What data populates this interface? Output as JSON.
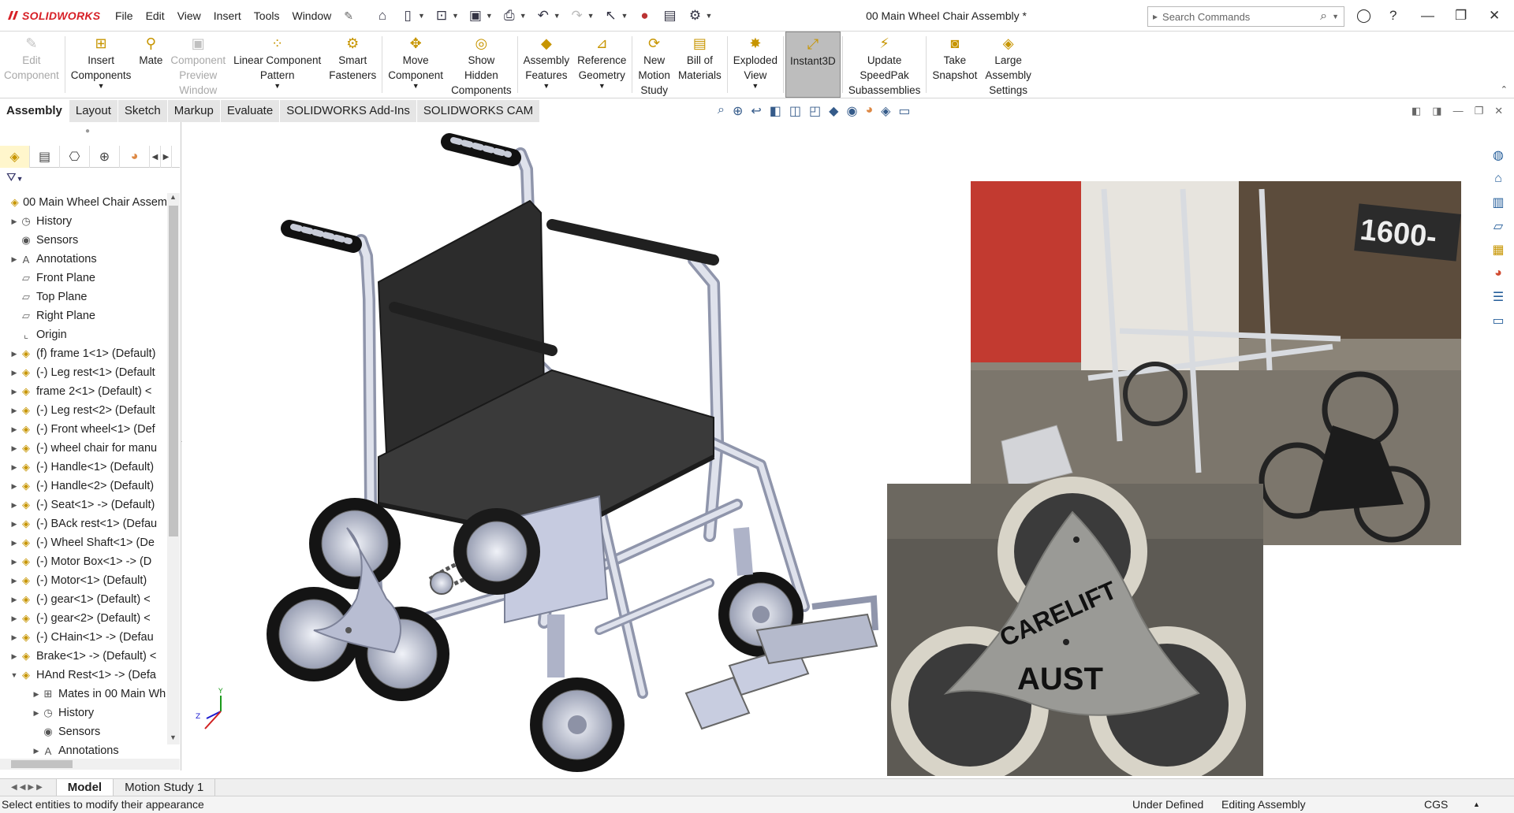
{
  "app": {
    "logo": "SOLIDWORKS",
    "document_title": "00 Main Wheel Chair Assembly *"
  },
  "menu": [
    "File",
    "Edit",
    "View",
    "Insert",
    "Tools",
    "Window"
  ],
  "search": {
    "placeholder": "Search Commands"
  },
  "ribbon": [
    {
      "label": "Edit\nComponent",
      "icon": "edit-component-icon",
      "disabled": true
    },
    {
      "label": "Insert\nComponents",
      "icon": "insert-components-icon",
      "caret": true
    },
    {
      "label": "Mate",
      "icon": "mate-icon"
    },
    {
      "label": "Component\nPreview\nWindow",
      "icon": "preview-window-icon",
      "disabled": true
    },
    {
      "label": "Linear Component\nPattern",
      "icon": "linear-pattern-icon",
      "caret": true
    },
    {
      "label": "Smart\nFasteners",
      "icon": "smart-fasteners-icon"
    },
    {
      "label": "Move\nComponent",
      "icon": "move-component-icon",
      "caret": true
    },
    {
      "label": "Show\nHidden\nComponents",
      "icon": "show-hidden-icon"
    },
    {
      "label": "Assembly\nFeatures",
      "icon": "assembly-features-icon",
      "caret": true
    },
    {
      "label": "Reference\nGeometry",
      "icon": "reference-geometry-icon",
      "caret": true
    },
    {
      "label": "New\nMotion\nStudy",
      "icon": "motion-study-icon"
    },
    {
      "label": "Bill of\nMaterials",
      "icon": "bill-of-materials-icon"
    },
    {
      "label": "Exploded\nView",
      "icon": "exploded-view-icon",
      "caret": true
    },
    {
      "label": "Instant3D",
      "icon": "instant3d-icon",
      "active": true
    },
    {
      "label": "Update\nSpeedPak\nSubassemblies",
      "icon": "speedpak-icon"
    },
    {
      "label": "Take\nSnapshot",
      "icon": "snapshot-icon"
    },
    {
      "label": "Large\nAssembly\nSettings",
      "icon": "large-assembly-icon"
    }
  ],
  "tabs": [
    "Assembly",
    "Layout",
    "Sketch",
    "Markup",
    "Evaluate",
    "SOLIDWORKS Add-Ins",
    "SOLIDWORKS CAM"
  ],
  "tree": [
    {
      "label": "00 Main Wheel Chair Assem",
      "icon": "assembly-icon",
      "exp": "",
      "level": 0
    },
    {
      "label": "History",
      "icon": "history-icon",
      "exp": "▶",
      "level": 1
    },
    {
      "label": "Sensors",
      "icon": "sensors-icon",
      "exp": "",
      "level": 1
    },
    {
      "label": "Annotations",
      "icon": "annotations-icon",
      "exp": "▶",
      "level": 1
    },
    {
      "label": "Front Plane",
      "icon": "plane-icon",
      "exp": "",
      "level": 1
    },
    {
      "label": "Top Plane",
      "icon": "plane-icon",
      "exp": "",
      "level": 1
    },
    {
      "label": "Right Plane",
      "icon": "plane-icon",
      "exp": "",
      "level": 1
    },
    {
      "label": "Origin",
      "icon": "origin-icon",
      "exp": "",
      "level": 1
    },
    {
      "label": "(f) frame 1<1> (Default)",
      "icon": "part-icon",
      "exp": "▶",
      "level": 1
    },
    {
      "label": "(-) Leg rest<1> (Default",
      "icon": "part-icon",
      "exp": "▶",
      "level": 1
    },
    {
      "label": "frame 2<1> (Default) <",
      "icon": "part-icon",
      "exp": "▶",
      "level": 1
    },
    {
      "label": "(-) Leg rest<2> (Default",
      "icon": "part-icon",
      "exp": "▶",
      "level": 1
    },
    {
      "label": "(-) Front wheel<1> (Def",
      "icon": "part-icon",
      "exp": "▶",
      "level": 1
    },
    {
      "label": "(-) wheel chair for manu",
      "icon": "part-icon",
      "exp": "▶",
      "level": 1
    },
    {
      "label": "(-) Handle<1> (Default)",
      "icon": "part-icon",
      "exp": "▶",
      "level": 1
    },
    {
      "label": "(-) Handle<2> (Default)",
      "icon": "part-icon",
      "exp": "▶",
      "level": 1
    },
    {
      "label": "(-) Seat<1> -> (Default)",
      "icon": "part-icon",
      "exp": "▶",
      "level": 1
    },
    {
      "label": "(-) BAck rest<1> (Defau",
      "icon": "part-icon",
      "exp": "▶",
      "level": 1
    },
    {
      "label": "(-) Wheel Shaft<1> (De",
      "icon": "part-icon",
      "exp": "▶",
      "level": 1
    },
    {
      "label": "(-) Motor Box<1> -> (D",
      "icon": "part-icon",
      "exp": "▶",
      "level": 1
    },
    {
      "label": "(-) Motor<1> (Default)",
      "icon": "part-icon",
      "exp": "▶",
      "level": 1
    },
    {
      "label": "(-) gear<1> (Default) <",
      "icon": "part-icon",
      "exp": "▶",
      "level": 1
    },
    {
      "label": "(-) gear<2> (Default) <",
      "icon": "part-icon",
      "exp": "▶",
      "level": 1
    },
    {
      "label": "(-) CHain<1> -> (Defau",
      "icon": "part-icon",
      "exp": "▶",
      "level": 1
    },
    {
      "label": "Brake<1> -> (Default) <",
      "icon": "part-icon",
      "exp": "▶",
      "level": 1
    },
    {
      "label": "HAnd Rest<1> -> (Defa",
      "icon": "part-icon",
      "exp": "▼",
      "level": 1
    },
    {
      "label": "Mates in 00 Main Wh",
      "icon": "mates-icon",
      "exp": "▶",
      "level": 2
    },
    {
      "label": "History",
      "icon": "history-icon",
      "exp": "▶",
      "level": 2
    },
    {
      "label": "Sensors",
      "icon": "sensors-icon",
      "exp": "",
      "level": 2
    },
    {
      "label": "Annotations",
      "icon": "annotations-icon",
      "exp": "▶",
      "level": 2
    }
  ],
  "photos": {
    "top_sign": "1600-",
    "plate_line1": "CARELIFT",
    "plate_line2": "AUST"
  },
  "bottom_tabs": [
    "Model",
    "Motion Study 1"
  ],
  "status": {
    "message": "Select entities to modify their appearance",
    "state": "Under Defined",
    "mode": "Editing Assembly",
    "units": "CGS"
  },
  "colors": {
    "brand": "#d71f26",
    "frame": "#c7cde0",
    "seat": "#2f2f2f",
    "tire": "#151515",
    "active_tool": "#bdbdbd"
  }
}
